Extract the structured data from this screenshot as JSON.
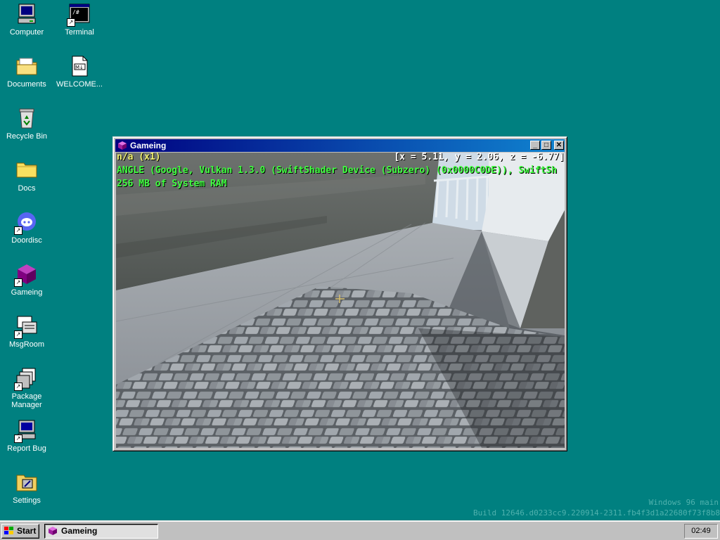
{
  "desktop": {
    "icons": [
      {
        "label": "Computer"
      },
      {
        "label": "Terminal"
      },
      {
        "label": "Documents"
      },
      {
        "label": "WELCOME..."
      },
      {
        "label": "Recycle Bin"
      },
      {
        "label": "Docs"
      },
      {
        "label": "Doordisc"
      },
      {
        "label": "Gameing"
      },
      {
        "label": "MsgRoom"
      },
      {
        "label": "Package Manager"
      },
      {
        "label": "Report Bug"
      },
      {
        "label": "Settings"
      }
    ],
    "watermark": {
      "line1": "Windows 96 main",
      "line2": "Build 12646.d0233cc9.220914-2311.fb4f3d1a22680f73f8b8"
    }
  },
  "window": {
    "title": "Gameing",
    "buttons": {
      "minimize": "_",
      "maximize": "□",
      "close": "✕"
    },
    "hud": {
      "status": "n/a (x1)",
      "coords": "[x = 5.11, y = 2.06, z = -6.77]",
      "renderer": "ANGLE (Google, Vulkan 1.3.0 (SwiftShader Device (Subzero) (0x0000C0DE)), SwiftSh",
      "memory": "256 MB of System RAM"
    }
  },
  "taskbar": {
    "start_label": "Start",
    "task_label": "Gameing",
    "clock": "02:49"
  },
  "colors": {
    "desktop_bg": "#008080",
    "titlebar_start": "#000080",
    "titlebar_end": "#1084d0",
    "hud_yellow": "#f0f070",
    "hud_green": "#40ff40",
    "hud_white": "#ffffff"
  }
}
